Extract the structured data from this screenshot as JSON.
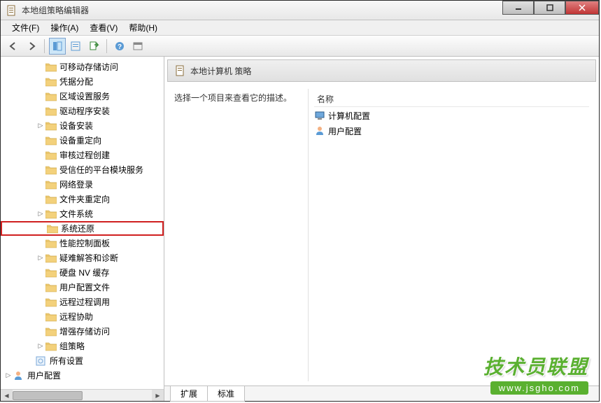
{
  "window": {
    "title": "本地组策略编辑器"
  },
  "menu": {
    "file": "文件(F)",
    "action": "操作(A)",
    "view": "查看(V)",
    "help": "帮助(H)"
  },
  "tree": {
    "items": [
      {
        "label": "可移动存储访问",
        "indent": 68,
        "expand": ""
      },
      {
        "label": "凭据分配",
        "indent": 68,
        "expand": ""
      },
      {
        "label": "区域设置服务",
        "indent": 68,
        "expand": ""
      },
      {
        "label": "驱动程序安装",
        "indent": 68,
        "expand": ""
      },
      {
        "label": "设备安装",
        "indent": 68,
        "expand": "▷"
      },
      {
        "label": "设备重定向",
        "indent": 68,
        "expand": ""
      },
      {
        "label": "审核过程创建",
        "indent": 68,
        "expand": ""
      },
      {
        "label": "受信任的平台模块服务",
        "indent": 68,
        "expand": ""
      },
      {
        "label": "网络登录",
        "indent": 68,
        "expand": ""
      },
      {
        "label": "文件夹重定向",
        "indent": 68,
        "expand": ""
      },
      {
        "label": "文件系统",
        "indent": 68,
        "expand": "▷"
      },
      {
        "label": "系统还原",
        "indent": 68,
        "expand": "",
        "highlighted": true
      },
      {
        "label": "性能控制面板",
        "indent": 68,
        "expand": ""
      },
      {
        "label": "疑难解答和诊断",
        "indent": 68,
        "expand": "▷"
      },
      {
        "label": "硬盘 NV 缓存",
        "indent": 68,
        "expand": ""
      },
      {
        "label": "用户配置文件",
        "indent": 68,
        "expand": ""
      },
      {
        "label": "远程过程调用",
        "indent": 68,
        "expand": ""
      },
      {
        "label": "远程协助",
        "indent": 68,
        "expand": ""
      },
      {
        "label": "增强存储访问",
        "indent": 68,
        "expand": ""
      },
      {
        "label": "组策略",
        "indent": 68,
        "expand": "▷"
      }
    ],
    "all_settings": "所有设置",
    "user_config": "用户配置"
  },
  "right": {
    "header_title": "本地计算机 策略",
    "description_hint": "选择一个项目来查看它的描述。",
    "name_header": "名称",
    "items": [
      {
        "label": "计算机配置"
      },
      {
        "label": "用户配置"
      }
    ]
  },
  "tabs": {
    "extended": "扩展",
    "standard": "标准"
  },
  "watermark": {
    "text": "技术员联盟",
    "url": "www.jsgho.com"
  }
}
